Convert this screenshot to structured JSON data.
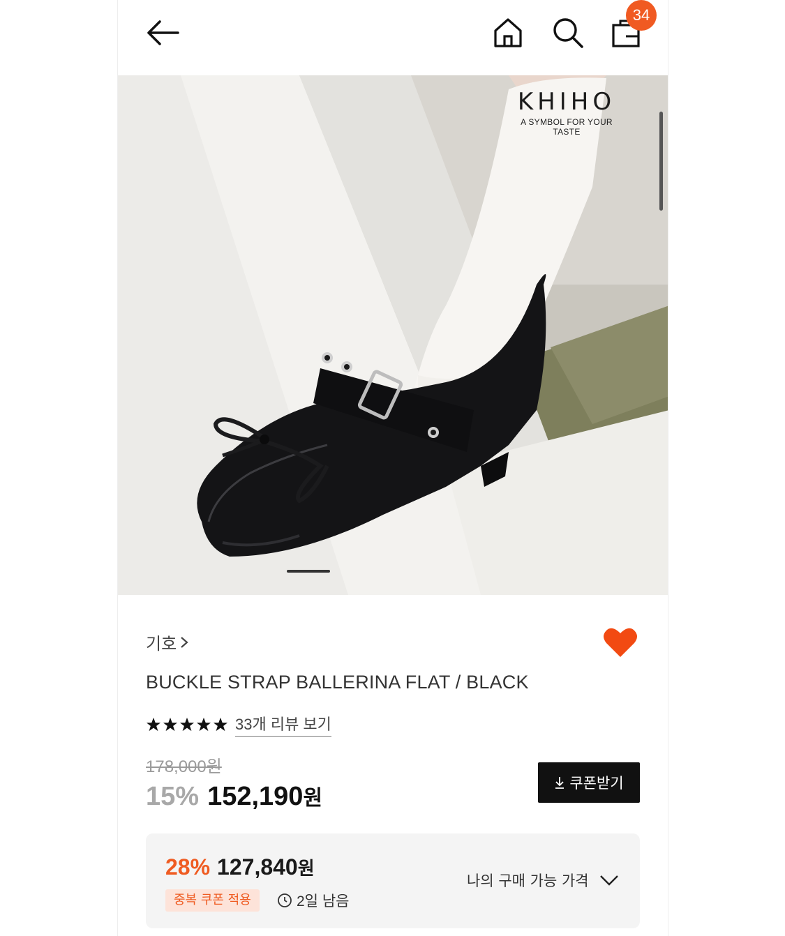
{
  "header": {
    "back_icon": "arrow-left-icon",
    "home_icon": "home-icon",
    "search_icon": "search-icon",
    "bag_icon": "shopping-bag-icon",
    "cart_count": "34",
    "badge_color": "#f05a22"
  },
  "hero": {
    "brand_logo_text": "KHIHO",
    "brand_tagline": "A SYMBOL FOR YOUR TASTE",
    "slide_indicator": "1"
  },
  "product": {
    "brand": "기호",
    "brand_chevron_icon": "chevron-right-icon",
    "wishlist_icon": "heart-icon",
    "wishlist_color": "#f24a12",
    "title": "BUCKLE STRAP BALLERINA FLAT / BLACK",
    "rating_stars": 5,
    "review_link": "33개 리뷰 보기",
    "original_price": "178,000원",
    "discount_rate": "15%",
    "sale_price": "152,190",
    "currency": "원",
    "coupon_button": "쿠폰받기",
    "coupon_icon": "download-icon"
  },
  "promo": {
    "discount_rate": "28%",
    "price": "127,840",
    "currency": "원",
    "coupon_chip": "중복 쿠폰 적용",
    "time_left": "2일 남음",
    "clock_icon": "clock-icon",
    "my_price_label": "나의 구매 가능 가격",
    "expand_icon": "chevron-down-icon",
    "accent_color": "#ef5b21"
  }
}
